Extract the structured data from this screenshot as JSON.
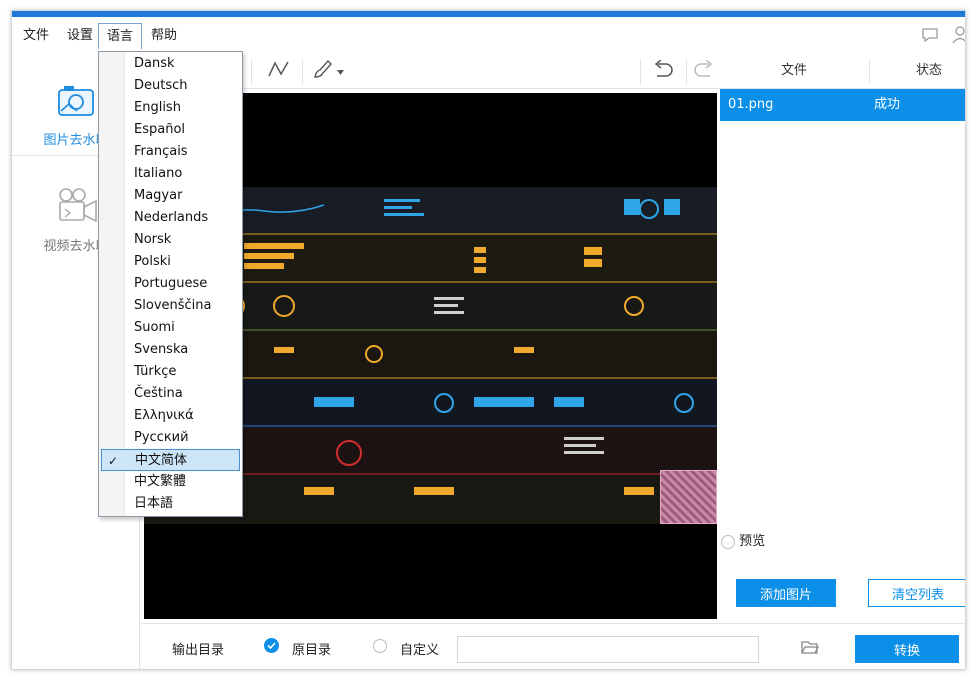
{
  "menubar": {
    "file": "文件",
    "settings": "设置",
    "language": "语言",
    "help": "帮助"
  },
  "sidebar": {
    "items": [
      {
        "label": "图片去水印",
        "icon": "photo-icon",
        "active": true
      },
      {
        "label": "视频去水印",
        "icon": "video-camera-icon",
        "active": false
      }
    ]
  },
  "toolbar": {
    "tools": [
      "polyline-icon",
      "brush-icon",
      "undo-icon",
      "redo-icon"
    ]
  },
  "file_panel": {
    "col_file": "文件",
    "col_status": "状态",
    "rows": [
      {
        "file": "01.png",
        "status": "成功"
      }
    ],
    "preview_label": "预览",
    "add_button": "添加图片",
    "clear_button": "清空列表"
  },
  "footer": {
    "output_dir_label": "输出目录",
    "option_original": "原目录",
    "option_custom": "自定义",
    "path_value": "",
    "convert_button": "转换"
  },
  "language_menu": {
    "items": [
      "Dansk",
      "Deutsch",
      "English",
      "Español",
      "Français",
      "Italiano",
      "Magyar",
      "Nederlands",
      "Norsk",
      "Polski",
      "Portuguese",
      "Slovenščina",
      "Suomi",
      "Svenska",
      "Türkçe",
      "Čeština",
      "Ελληνικά",
      "Русский",
      "中文简体",
      "中文繁體",
      "日本語"
    ],
    "selected": "中文简体",
    "checkmark": "✓"
  },
  "colors": {
    "accent": "#0b8fe8",
    "title_strip": "#1f7ad6",
    "canvas_bg": "#000000"
  }
}
